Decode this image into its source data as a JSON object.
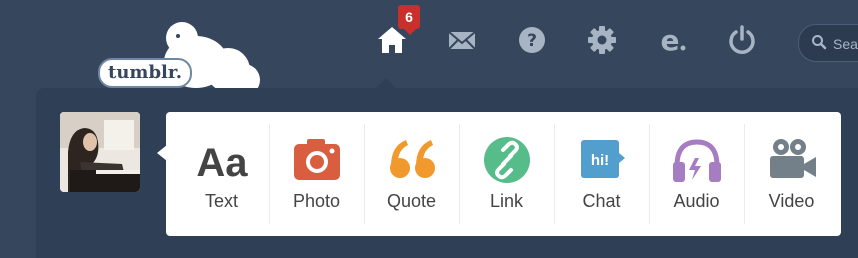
{
  "brand": {
    "logo_text": "tumblr."
  },
  "nav": {
    "dashboard": {
      "icon": "home-icon",
      "badge": "6"
    },
    "messages": {
      "icon": "envelope-icon"
    },
    "help": {
      "icon": "question-icon"
    },
    "settings": {
      "icon": "gear-icon"
    },
    "explore": {
      "icon": "e-icon"
    },
    "logout": {
      "icon": "power-icon"
    }
  },
  "search": {
    "placeholder": "Search"
  },
  "post_types": [
    {
      "label": "Text",
      "icon": "text-icon",
      "glyph": "Aa",
      "color": "#444444"
    },
    {
      "label": "Photo",
      "icon": "camera-icon",
      "color": "#d95e40"
    },
    {
      "label": "Quote",
      "icon": "quote-icon",
      "color": "#f2992e"
    },
    {
      "label": "Link",
      "icon": "link-icon",
      "color": "#56bc8a"
    },
    {
      "label": "Chat",
      "icon": "chat-icon",
      "glyph": "hi!",
      "color": "#529ecc"
    },
    {
      "label": "Audio",
      "icon": "headphones-icon",
      "color": "#a77dc2"
    },
    {
      "label": "Video",
      "icon": "video-camera-icon",
      "color": "#748089"
    }
  ]
}
